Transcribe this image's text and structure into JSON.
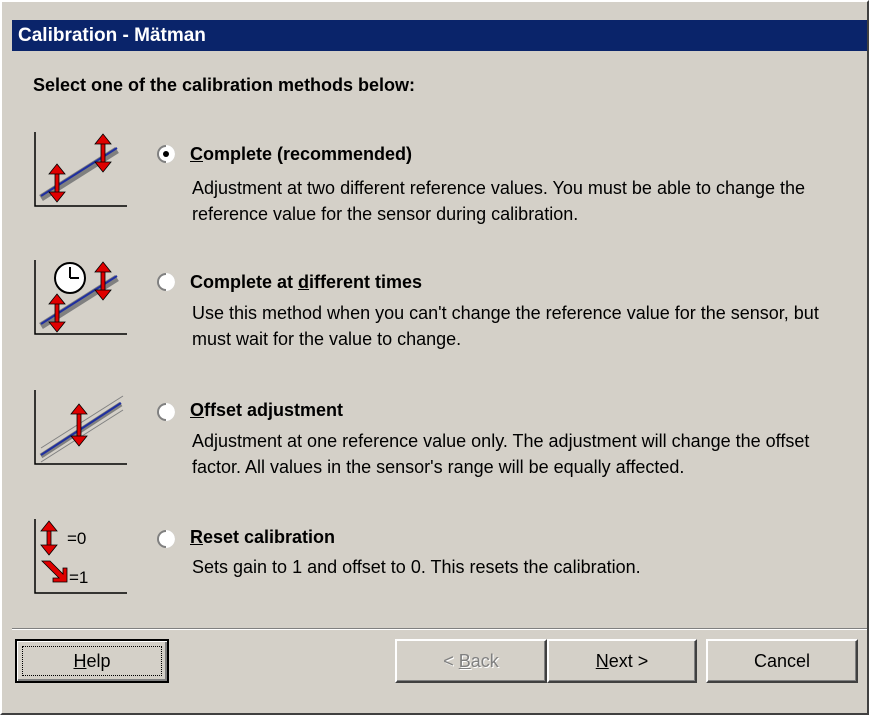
{
  "window": {
    "title": "Calibration - Mätman"
  },
  "heading": "Select one of the calibration methods below:",
  "options": [
    {
      "label_pre": "",
      "label_u": "C",
      "label_post": "omplete (recommended)",
      "desc": "Adjustment at two different reference values. You must be able to change the reference value for the sensor during calibration.",
      "selected": true,
      "icon": "two-point-calibration-icon"
    },
    {
      "label_pre": "Complete at ",
      "label_u": "d",
      "label_post": "ifferent times",
      "desc": "Use this method when you can't change the reference value for the sensor, but must wait for the value to change.",
      "selected": false,
      "icon": "timed-calibration-icon"
    },
    {
      "label_pre": "",
      "label_u": "O",
      "label_post": "ffset adjustment",
      "desc": "Adjustment at one reference value only. The adjustment will change the offset factor. All values in the sensor's range will be equally affected.",
      "selected": false,
      "icon": "offset-calibration-icon"
    },
    {
      "label_pre": "",
      "label_u": "R",
      "label_post": "eset calibration",
      "desc": "Sets gain to 1 and offset to 0. This resets the calibration.",
      "selected": false,
      "icon": "reset-calibration-icon",
      "icon_text_top": "=0",
      "icon_text_bottom": "=1"
    }
  ],
  "buttons": {
    "help": {
      "u": "H",
      "rest": "elp"
    },
    "back": {
      "pre": "< ",
      "u": "B",
      "rest": "ack",
      "disabled": true
    },
    "next": {
      "u": "N",
      "rest": "ext >"
    },
    "cancel": {
      "label": "Cancel"
    }
  },
  "colors": {
    "titlebar": "#0a246a",
    "face": "#d4d0c8",
    "arrow_red": "#e00000",
    "line_blue": "#1f2fa0"
  }
}
